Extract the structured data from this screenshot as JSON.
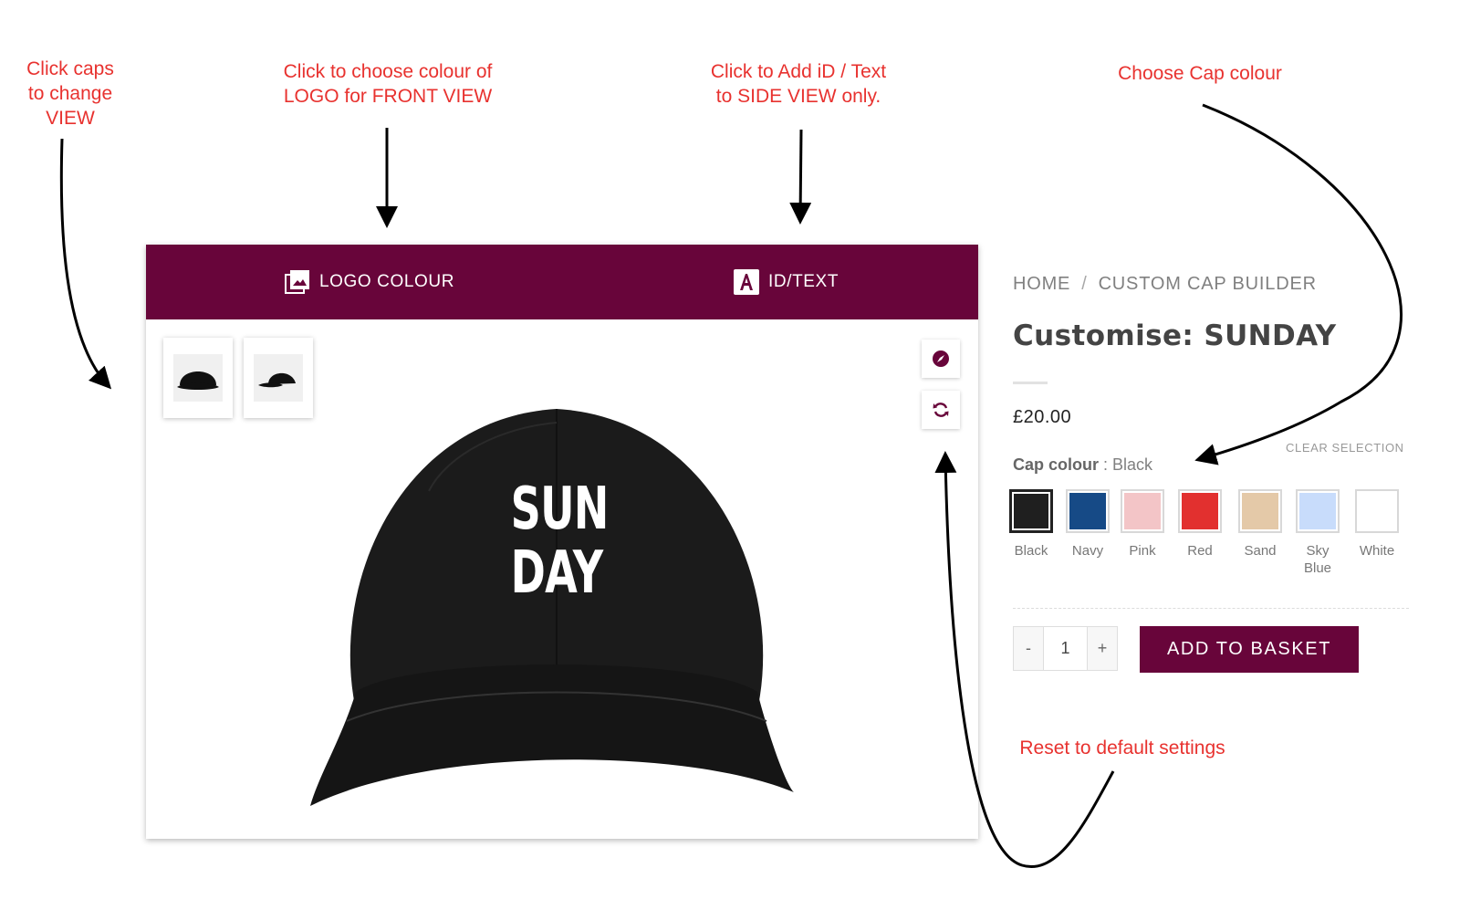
{
  "annotations": {
    "views": "Click caps\nto change\nVIEW",
    "logo": "Click to choose colour of\nLOGO for FRONT VIEW",
    "idtext": "Click to Add iD / Text\nto SIDE VIEW only.",
    "cap_colour": "Choose Cap colour",
    "reset": "Reset to default settings"
  },
  "builder": {
    "tabs": [
      {
        "label": "LOGO COLOUR",
        "icon": "image-icon"
      },
      {
        "label": "ID/TEXT",
        "icon": "text-a-icon"
      }
    ],
    "thumbnails": [
      "front-view",
      "side-view"
    ],
    "tools": [
      "compass-icon",
      "refresh-icon"
    ],
    "cap_text_line1": "SUN",
    "cap_text_line2": "DAY"
  },
  "product": {
    "breadcrumb": {
      "home": "HOME",
      "separator": "/",
      "current": "CUSTOM CAP BUILDER"
    },
    "title": "Customise: SUNDAY",
    "price": "£20.00",
    "option_label": "Cap colour",
    "option_separator": " : ",
    "option_value": "Black",
    "clear_selection": "CLEAR SELECTION",
    "swatches": [
      {
        "name": "Black",
        "color": "#1f1f1f"
      },
      {
        "name": "Navy",
        "color": "#164a86"
      },
      {
        "name": "Pink",
        "color": "#f3c5c7"
      },
      {
        "name": "Red",
        "color": "#e2302f"
      },
      {
        "name": "Sand",
        "color": "#e4c9a8"
      },
      {
        "name": "Sky Blue",
        "color": "#c8dcfb"
      },
      {
        "name": "White",
        "color": "#ffffff"
      }
    ],
    "selected_colour": "Black",
    "quantity": "1",
    "minus": "-",
    "plus": "+",
    "add_to_basket": "ADD TO BASKET"
  },
  "colors": {
    "brand": "#68053a",
    "annotation": "#e8322f"
  }
}
